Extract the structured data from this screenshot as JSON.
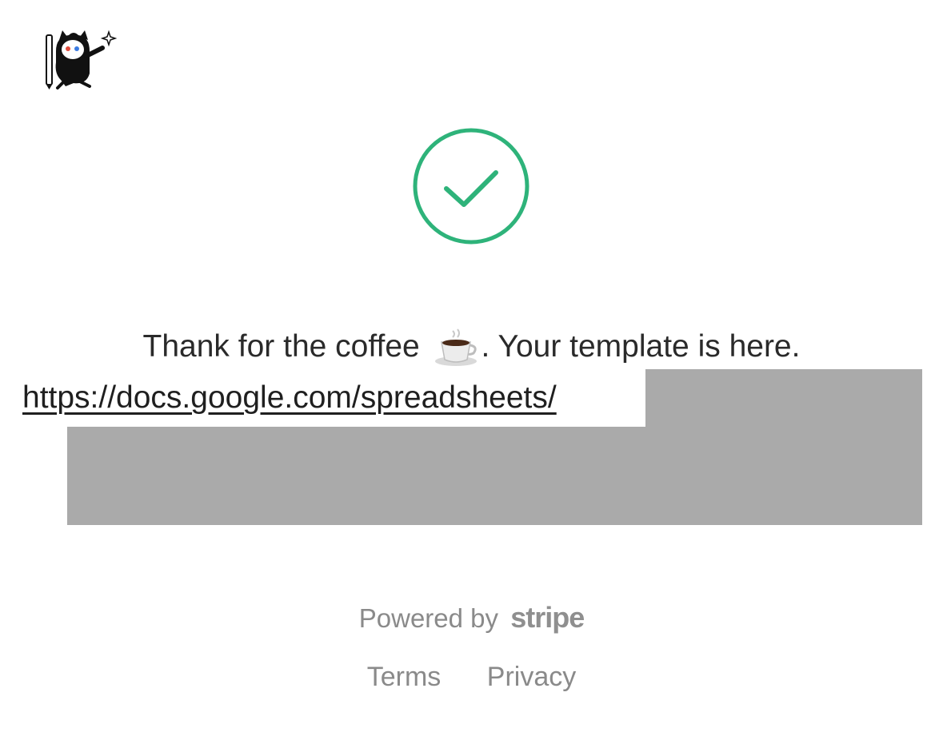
{
  "page": {
    "logo_icon": "owl-mascot-icon",
    "status_icon": "check-circle-icon",
    "accent_color": "#2eb37a"
  },
  "message": {
    "text_before": "Thank for the coffee",
    "emoji_icon": "coffee-cup-icon",
    "text_after": ". Your template is here."
  },
  "link": {
    "text": "https://docs.google.com/spreadsheets/"
  },
  "footer": {
    "powered_by": "Powered by",
    "brand": "stripe",
    "terms": "Terms",
    "privacy": "Privacy"
  }
}
